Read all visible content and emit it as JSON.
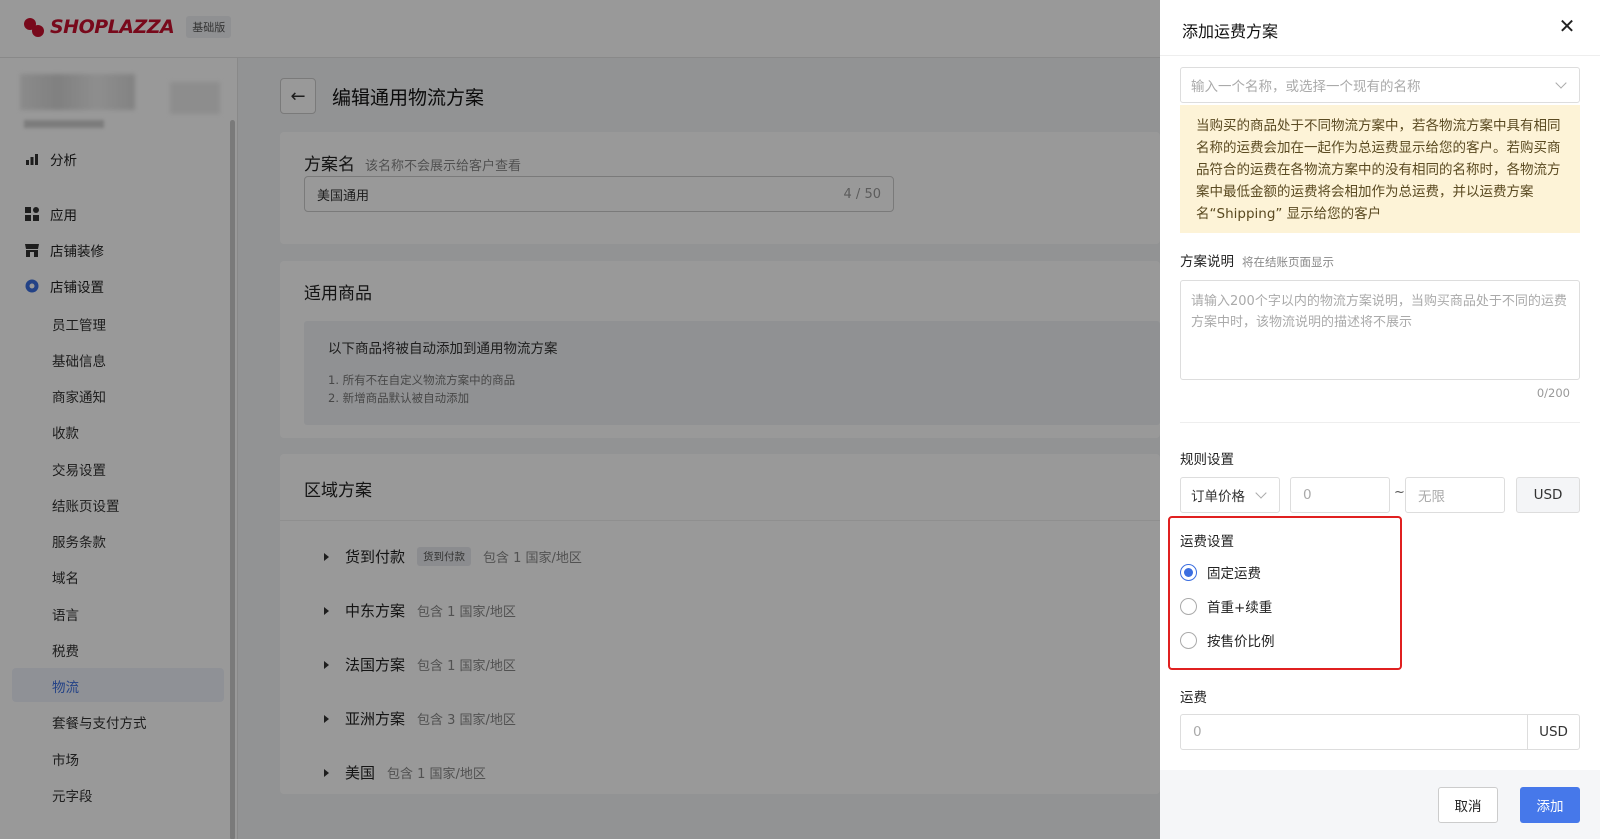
{
  "app": {
    "brand": "SHOPLAZZA",
    "plan_badge": "基础版"
  },
  "sidebar": {
    "top_items": [
      {
        "label": "分析",
        "icon": "bar-chart-icon"
      },
      {
        "label": "应用",
        "icon": "apps-grid-icon"
      },
      {
        "label": "店铺装修",
        "icon": "storefront-icon"
      },
      {
        "label": "店铺设置",
        "icon": "gear-icon"
      }
    ],
    "settings_items": [
      "员工管理",
      "基础信息",
      "商家通知",
      "收款",
      "交易设置",
      "结账页设置",
      "服务条款",
      "域名",
      "语言",
      "税费",
      "物流",
      "套餐与支付方式",
      "市场",
      "元字段"
    ],
    "active_item": "物流"
  },
  "main": {
    "page_title": "编辑通用物流方案",
    "plan_name": {
      "label": "方案名",
      "hint": "该名称不会展示给客户查看",
      "value": "美国通用",
      "count": "4 / 50"
    },
    "products": {
      "title": "适用商品",
      "info_main": "以下商品将被自动添加到通用物流方案",
      "info_lines": [
        "1. 所有不在自定义物流方案中的商品",
        "2. 新增商品默认被自动添加"
      ]
    },
    "regions": {
      "title": "区域方案",
      "items": [
        {
          "name": "货到付款",
          "tag": "货到付款",
          "count": "包含 1 国家/地区"
        },
        {
          "name": "中东方案",
          "tag": "",
          "count": "包含 1 国家/地区"
        },
        {
          "name": "法国方案",
          "tag": "",
          "count": "包含 1 国家/地区"
        },
        {
          "name": "亚洲方案",
          "tag": "",
          "count": "包含 3 国家/地区"
        },
        {
          "name": "美国",
          "tag": "",
          "count": "包含 1 国家/地区"
        }
      ]
    }
  },
  "drawer": {
    "title": "添加运费方案",
    "name_placeholder": "输入一个名称，或选择一个现有的名称",
    "warning": "当购买的商品处于不同物流方案中，若各物流方案中具有相同名称的运费会加在一起作为总运费显示给您的客户。若购买商品符合的运费在各物流方案中的没有相同的名称时，各物流方案中最低金额的运费将会相加作为总运费，并以运费方案名“Shipping” 显示给您的客户",
    "desc_label": "方案说明",
    "desc_sub": "将在结账页面显示",
    "desc_placeholder": "请输入200个字以内的物流方案说明，当购买商品处于不同的运费方案中时，该物流说明的描述将不展示",
    "desc_count": "0/200",
    "rule_label": "规则设置",
    "rule_type": "订单价格",
    "rule_min_placeholder": "0",
    "rule_sep": "~",
    "rule_max_placeholder": "无限",
    "rule_unit": "USD",
    "fee_setting_label": "运费设置",
    "fee_options": [
      "固定运费",
      "首重+续重",
      "按售价比例"
    ],
    "fee_selected": "固定运费",
    "fee_label": "运费",
    "fee_placeholder": "0",
    "fee_unit": "USD",
    "cancel": "取消",
    "add": "添加",
    "accent_color": "#4678ea",
    "highlight_color": "#e02020"
  }
}
